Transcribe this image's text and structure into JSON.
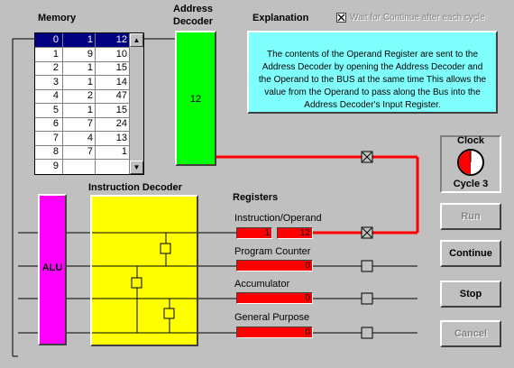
{
  "memory": {
    "title": "Memory",
    "rows": [
      {
        "addr": "0",
        "a": "1",
        "b": "12"
      },
      {
        "addr": "1",
        "a": "9",
        "b": "10"
      },
      {
        "addr": "2",
        "a": "1",
        "b": "15"
      },
      {
        "addr": "3",
        "a": "1",
        "b": "14"
      },
      {
        "addr": "4",
        "a": "2",
        "b": "47"
      },
      {
        "addr": "5",
        "a": "1",
        "b": "15"
      },
      {
        "addr": "6",
        "a": "7",
        "b": "24"
      },
      {
        "addr": "7",
        "a": "4",
        "b": "13"
      },
      {
        "addr": "8",
        "a": "7",
        "b": "1"
      },
      {
        "addr": "9",
        "a": "",
        "b": ""
      }
    ],
    "scroll_up": "▲",
    "scroll_down": "▼"
  },
  "address_decoder": {
    "title_line1": "Address",
    "title_line2": "Decoder",
    "value": "12"
  },
  "explanation": {
    "title": "Explanation",
    "wait_checkbox_label": "Wait for Continue after each cycle",
    "text": "The contents of the Operand Register are sent to the Address Decoder by opening the Address Decoder and the Operand to the BUS at the same time  This allows the value from the Operand to pass along the Bus into the Address Decoder's Input Register."
  },
  "clock": {
    "title": "Clock",
    "cycle_label": "Cycle 3"
  },
  "alu": {
    "label": "ALU"
  },
  "instruction_decoder": {
    "title": "Instruction Decoder"
  },
  "registers": {
    "title": "Registers",
    "instruction_operand": {
      "label": "Instruction/Operand",
      "instruction": "1",
      "operand": "12"
    },
    "program_counter": {
      "label": "Program Counter",
      "value": "0"
    },
    "accumulator": {
      "label": "Accumulator",
      "value": "0"
    },
    "general_purpose": {
      "label": "General Purpose",
      "value": "0"
    }
  },
  "buttons": {
    "run": "Run",
    "continue": "Continue",
    "stop": "Stop",
    "cancel": "Cancel"
  },
  "gate_marks": {
    "closed": "",
    "open": "×"
  },
  "colors": {
    "bus_active": "#ff0000",
    "bus_idle": "#000000",
    "address_decoder": "#00ff00",
    "explanation_bg": "#80ffff",
    "alu": "#ff00ff",
    "instruction_decoder": "#ffff00",
    "register": "#ff0000",
    "selection": "#000080"
  }
}
